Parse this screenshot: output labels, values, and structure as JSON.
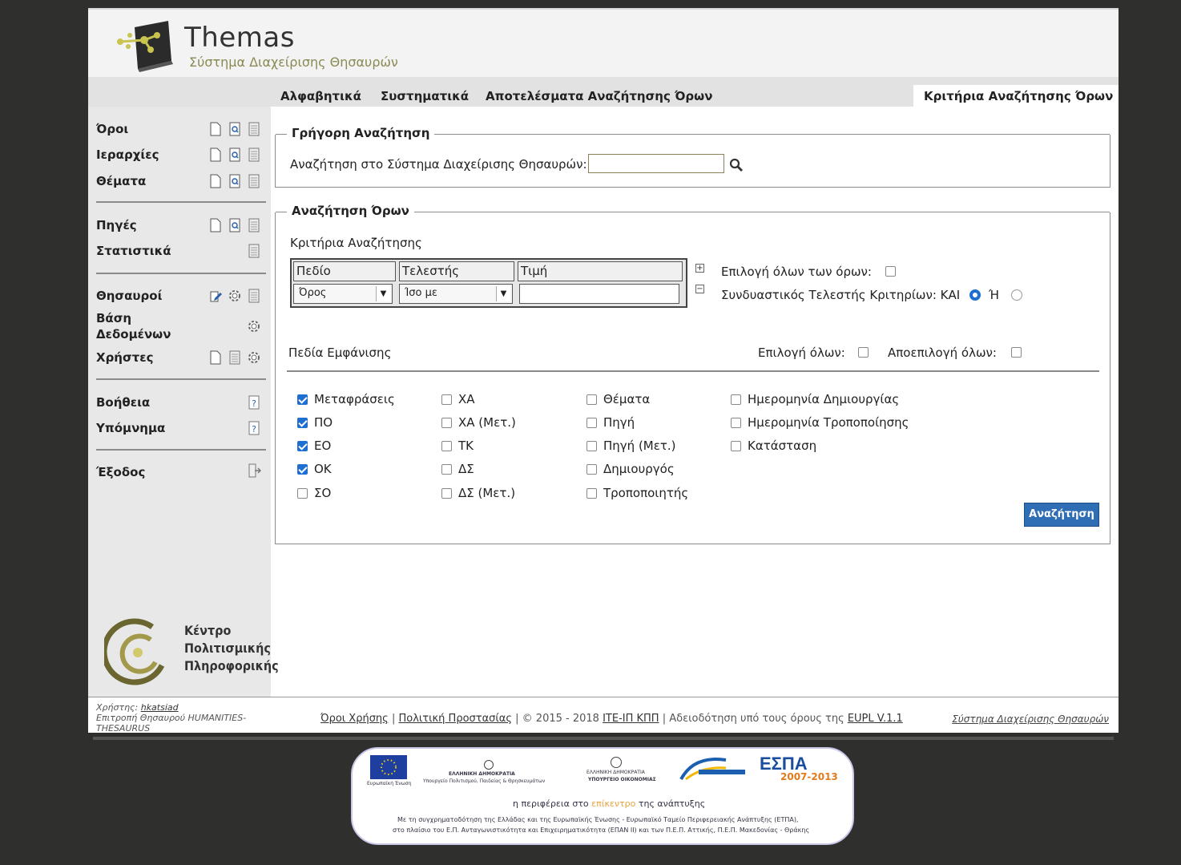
{
  "app": {
    "title": "Themas",
    "subtitle": "Σύστημα Διαχείρισης Θησαυρών"
  },
  "nav": {
    "tabs": [
      {
        "label": "Αλφαβητικά"
      },
      {
        "label": "Συστηματικά"
      },
      {
        "label": "Αποτελέσματα Αναζήτησης Όρων"
      }
    ],
    "active_tab": "Κριτήρια Αναζήτησης Όρων"
  },
  "sidebar": {
    "items": [
      {
        "label": "Όροι",
        "icons": [
          "new-document-icon",
          "search-document-icon",
          "list-document-icon"
        ]
      },
      {
        "label": "Ιεραρχίες",
        "icons": [
          "new-document-icon",
          "search-document-icon",
          "list-document-icon"
        ]
      },
      {
        "label": "Θέματα",
        "icons": [
          "new-document-icon",
          "search-document-icon",
          "list-document-icon"
        ]
      },
      {
        "label": "Πηγές",
        "icons": [
          "new-document-icon",
          "search-document-icon",
          "list-document-icon"
        ]
      },
      {
        "label": "Στατιστικά",
        "icons": [
          "list-document-icon"
        ]
      },
      {
        "label": "Θησαυροί",
        "icons": [
          "edit-icon",
          "gear-icon",
          "list-document-icon"
        ]
      },
      {
        "label": "Βάση Δεδομένων",
        "icons": [
          "gear-icon"
        ]
      },
      {
        "label": "Χρήστες",
        "icons": [
          "new-document-icon",
          "list-document-icon",
          "gear-icon"
        ]
      },
      {
        "label": "Βοήθεια",
        "icons": [
          "help-icon"
        ]
      },
      {
        "label": "Υπόμνημα",
        "icons": [
          "help-icon"
        ]
      },
      {
        "label": "Έξοδος",
        "icons": [
          "logout-icon"
        ]
      }
    ],
    "org_logo_text": [
      "Κέντρο",
      "Πολιτισμικής",
      "Πληροφορικής"
    ]
  },
  "quick_search": {
    "legend": "Γρήγορη Αναζήτηση",
    "label": "Αναζήτηση στο Σύστημα Διαχείρισης Θησαυρών:",
    "value": ""
  },
  "term_search": {
    "legend": "Αναζήτηση Όρων",
    "criteria_title": "Κριτήρια Αναζήτησης",
    "columns": [
      "Πεδίο",
      "Τελεστής",
      "Τιμή"
    ],
    "field_value": "Όρος",
    "operator_value": "Ίσο με",
    "value_value": "",
    "select_all_terms_label": "Επιλογή όλων των όρων:",
    "combine_label": "Συνδυαστικός Τελεστής Κριτηρίων: ΚΑΙ",
    "combine_and_selected": true,
    "or_label": "Ή",
    "display_fields_title": "Πεδία Εμφάνισης",
    "select_all_label": "Επιλογή όλων:",
    "deselect_all_label": "Αποεπιλογή όλων:",
    "fields": [
      [
        {
          "label": "Μεταφράσεις",
          "checked": true
        },
        {
          "label": "ΠΟ",
          "checked": true
        },
        {
          "label": "ΕΟ",
          "checked": true
        },
        {
          "label": "ΟΚ",
          "checked": true
        },
        {
          "label": "ΣΟ",
          "checked": false
        }
      ],
      [
        {
          "label": "ΧΑ",
          "checked": false
        },
        {
          "label": "ΧΑ (Μετ.)",
          "checked": false
        },
        {
          "label": "ΤΚ",
          "checked": false
        },
        {
          "label": "ΔΣ",
          "checked": false
        },
        {
          "label": "ΔΣ (Μετ.)",
          "checked": false
        }
      ],
      [
        {
          "label": "Θέματα",
          "checked": false
        },
        {
          "label": "Πηγή",
          "checked": false
        },
        {
          "label": "Πηγή (Μετ.)",
          "checked": false
        },
        {
          "label": "Δημιουργός",
          "checked": false
        },
        {
          "label": "Τροποποιητής",
          "checked": false
        }
      ],
      [
        {
          "label": "Ημερομηνία Δημιουργίας",
          "checked": false
        },
        {
          "label": "Ημερομηνία Τροποποίησης",
          "checked": false
        },
        {
          "label": "Κατάσταση",
          "checked": false
        }
      ]
    ],
    "search_button": "Αναζήτηση"
  },
  "footer": {
    "user_prefix": "Χρήστης:",
    "user_name": "hkatsiad",
    "thesaurus_line": "Επιτροπή Θησαυρού HUMANITIES-THESAURUS",
    "link_terms": "Όροι Χρήσης",
    "link_privacy": "Πολιτική Προστασίας",
    "copyright": "© 2015 - 2018",
    "link_org": "ΙΤΕ-ΙΠ ΚΠΠ",
    "license_text": "Αδειοδότηση υπό τους όρους της",
    "link_license": "EUPL V.1.1",
    "right_link": "Σύστημα Διαχείρισης Θησαυρών"
  },
  "banner": {
    "eu_label": "Ευρωπαϊκή Ένωση",
    "ministry1": "ΕΛΛΗΝΙΚΗ ΔΗΜΟΚΡΑΤΙΑ",
    "ministry1_sub": "Υπουργείο Πολιτισμού, Παιδείας & Θρησκευμάτων",
    "ministry2": "ΕΛΛΗΝΙΚΗ ΔΗΜΟΚΡΑΤΙΑ",
    "ministry2_sub": "ΥΠΟΥΡΓΕΙΟ ΟΙΚΟΝΟΜΙΑΣ",
    "espa": "ΕΣΠΑ",
    "espa_years": "2007-2013",
    "slogan_a": "η περιφέρεια στο",
    "slogan_b": "επίκεντρο",
    "slogan_c": "της ανάπτυξης",
    "fine1": "Με τη συγχρηματοδότηση της Ελλάδας και της Ευρωπαϊκής Ένωσης - Ευρωπαϊκό Ταμείο Περιφερειακής Ανάπτυξης (ΕΤΠΑ),",
    "fine2": "στο πλαίσιο του Ε.Π. Ανταγωνιστικότητα και Επιχειρηματικότητα (ΕΠΑΝ ΙΙ) και των Π.Ε.Π. Αττικής, Π.Ε.Π. Μακεδονίας - Θράκης"
  }
}
